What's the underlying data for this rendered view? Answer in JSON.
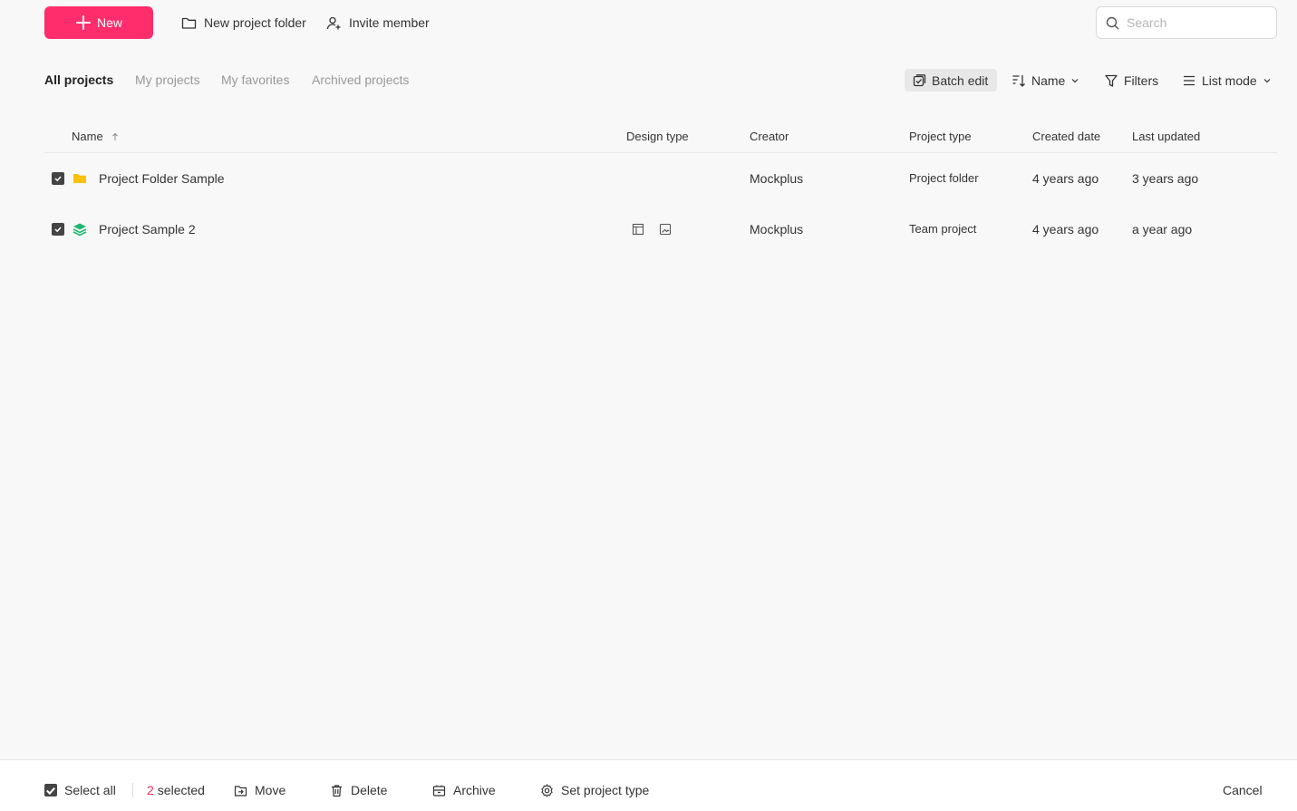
{
  "toolbar": {
    "new_label": "New",
    "new_folder_label": "New project folder",
    "invite_label": "Invite member",
    "search_placeholder": "Search"
  },
  "tabs": [
    {
      "label": "All projects",
      "active": true
    },
    {
      "label": "My projects",
      "active": false
    },
    {
      "label": "My favorites",
      "active": false
    },
    {
      "label": "Archived projects",
      "active": false
    }
  ],
  "view_controls": {
    "batch_edit_label": "Batch edit",
    "sort_label": "Name",
    "filters_label": "Filters",
    "view_mode_label": "List mode"
  },
  "table": {
    "columns": [
      "Name",
      "Design type",
      "Creator",
      "Project type",
      "Created date",
      "Last updated"
    ],
    "sort_column": "Name",
    "sort_direction": "ascending",
    "rows": [
      {
        "checked": true,
        "icon": "folder-icon",
        "name": "Project Folder Sample",
        "design_type_icons": [],
        "creator": "Mockplus",
        "project_type": "Project folder",
        "created": "4 years ago",
        "updated": "3 years ago"
      },
      {
        "checked": true,
        "icon": "layers-icon",
        "name": "Project Sample 2",
        "design_type_icons": [
          "layout-icon",
          "image-icon"
        ],
        "creator": "Mockplus",
        "project_type": "Team project",
        "created": "4 years ago",
        "updated": "a year ago"
      }
    ]
  },
  "bottom_bar": {
    "select_all_label": "Select all",
    "selected_count": "2",
    "selected_suffix": "selected",
    "move_label": "Move",
    "delete_label": "Delete",
    "archive_label": "Archive",
    "set_type_label": "Set project type",
    "cancel_label": "Cancel"
  },
  "colors": {
    "accent": "#ff2d6b",
    "folder": "#ffc107",
    "layers": "#1db86b",
    "count": "#e8315b"
  }
}
